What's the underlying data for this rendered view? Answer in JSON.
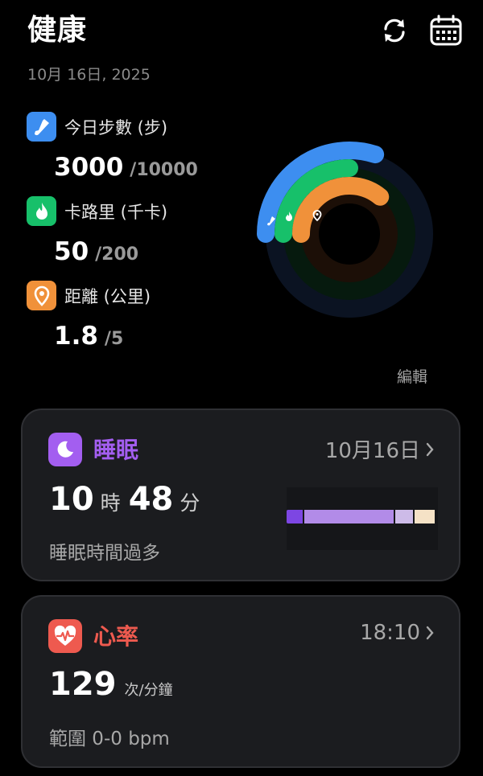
{
  "header": {
    "title": "健康",
    "date": "10月 16日, 2025",
    "sync_icon": "refresh-icon",
    "calendar_icon": "calendar-icon"
  },
  "activity": {
    "steps": {
      "label": "今日步數 (步)",
      "value": "3000",
      "goal": "/10000",
      "progress": 0.3,
      "color": "#3d8ef0",
      "icon": "shoe-icon"
    },
    "calories": {
      "label": "卡路里 (千卡)",
      "value": "50",
      "goal": "/200",
      "progress": 0.25,
      "color": "#17c06a",
      "icon": "flame-icon"
    },
    "distance": {
      "label": "距離 (公里)",
      "value": "1.8",
      "goal": "/5",
      "progress": 0.36,
      "color": "#f0913a",
      "icon": "location-pin-icon"
    },
    "edit_label": "編輯"
  },
  "sleep": {
    "title": "睡眠",
    "date": "10月16日",
    "hours": "10",
    "hours_unit": "時",
    "minutes": "48",
    "minutes_unit": "分",
    "status": "睡眠時間過多",
    "accent": "#a35ef0",
    "stages": [
      {
        "stage": "deep",
        "fraction": 0.11,
        "color": "#7d46e3"
      },
      {
        "stage": "light",
        "fraction": 0.61,
        "color": "#b28be8"
      },
      {
        "stage": "rem",
        "fraction": 0.12,
        "color": "#cdbbe8"
      },
      {
        "stage": "awake",
        "fraction": 0.14,
        "color": "#f5e2c6"
      }
    ]
  },
  "heart": {
    "title": "心率",
    "time": "18:10",
    "value": "129",
    "unit": "次/分鐘",
    "range": "範圍 0-0 bpm",
    "accent": "#ee5a4f"
  }
}
